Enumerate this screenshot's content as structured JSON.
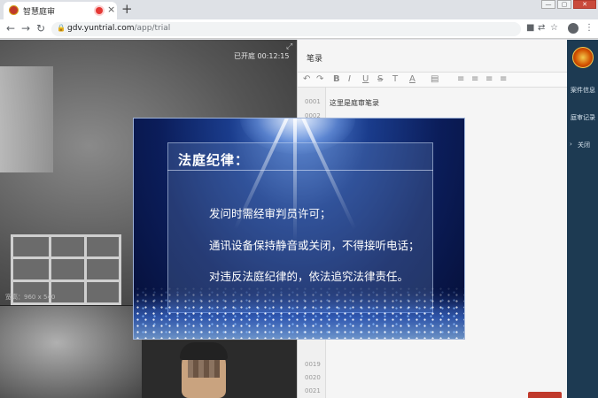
{
  "browser": {
    "tab_title": "智慧庭审",
    "tab_close": "×",
    "new_tab": "+",
    "url_host": "gdv.yuntrial.com",
    "url_path": "/app/trial",
    "nav_back": "←",
    "nav_forward": "→",
    "nav_reload": "↻",
    "lock": "🔒",
    "star": "☆",
    "translate": "⇄",
    "camera": "■",
    "menu": "⋮",
    "win_min": "—",
    "win_max": "▢",
    "win_close": "✕"
  },
  "video": {
    "timer": "已开庭 00:12:15",
    "caption": "宽高：960 x 540",
    "expand": "⤢"
  },
  "editor": {
    "title": "笔录",
    "tools": [
      "↶",
      "↷",
      "B",
      "I",
      "U",
      "S",
      "T",
      "A",
      "▤",
      "≡",
      "≡",
      "≡",
      "≡"
    ],
    "line_numbers": [
      "0001",
      "0002",
      "0019",
      "0020",
      "0021"
    ],
    "text": "这里是庭审笔录"
  },
  "sidebar": {
    "items": [
      "案件信息",
      "庭审记录",
      "关闭"
    ],
    "arrow": "›"
  },
  "modal": {
    "heading": "法庭纪律：",
    "rules": [
      "发问时需经审判员许可；",
      "通讯设备保持静音或关闭，不得接听电话；",
      "对违反法庭纪律的，依法追究法律责任。"
    ]
  },
  "colors": {
    "sidebar_bg": "#1d3a52",
    "modal_blue": "#0b1d5a",
    "record_red": "#e53935"
  }
}
